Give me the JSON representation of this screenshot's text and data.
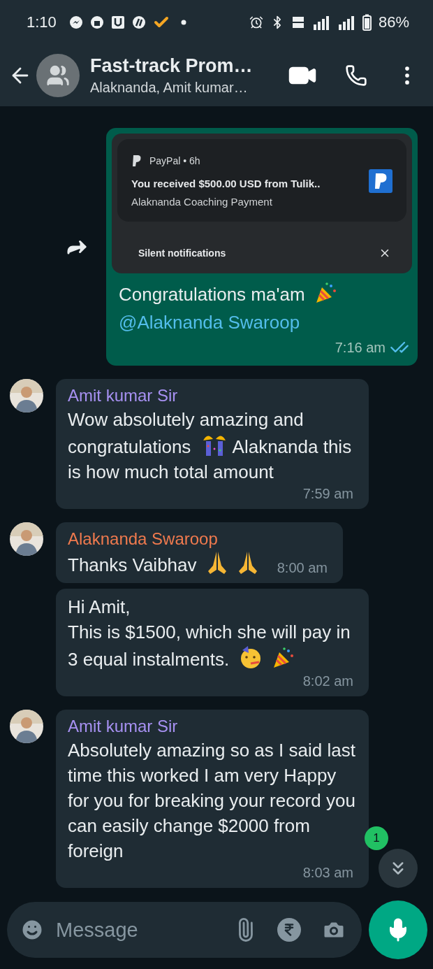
{
  "status_bar": {
    "time": "1:10",
    "battery": "86%"
  },
  "header": {
    "title": "Fast-track Prom…",
    "subtitle": "Alaknanda, Amit kumar…"
  },
  "messages": [
    {
      "kind": "outgoing",
      "notification": {
        "app": "PayPal • 6h",
        "title": "You received $500.00 USD from Tulik..",
        "body": "Alaknanda Coaching Payment",
        "footer": "Silent notifications"
      },
      "parts": [
        {
          "kind": "text",
          "text": "Congratulations ma'am"
        },
        {
          "kind": "popper"
        },
        {
          "kind": "mention",
          "text": "@Alaknanda Swaroop"
        }
      ],
      "time": "7:16 am",
      "read": true
    },
    {
      "kind": "incoming",
      "sender": "Amit kumar Sir",
      "color": "#a791f2",
      "parts": [
        {
          "kind": "text",
          "text": "Wow absolutely amazing and congratulations"
        },
        {
          "kind": "crackers"
        },
        {
          "kind": "text",
          "text": "Alaknanda this is how much total amount"
        }
      ],
      "time": "7:59 am"
    },
    {
      "kind": "incoming",
      "sender": "Alaknanda Swaroop",
      "color": "#f07a4e",
      "parts": [
        {
          "kind": "text",
          "text": "Thanks Vaibhav"
        },
        {
          "kind": "hands"
        },
        {
          "kind": "hands"
        }
      ],
      "time": "8:00 am"
    },
    {
      "kind": "incoming",
      "parts": [
        {
          "kind": "text",
          "text": "Hi Amit,"
        },
        {
          "kind": "break"
        },
        {
          "kind": "text",
          "text": "This is $1500, which she will pay in 3 equal instalments."
        },
        {
          "kind": "partyface"
        },
        {
          "kind": "popper"
        }
      ],
      "time": "8:02 am"
    },
    {
      "kind": "incoming",
      "sender": "Amit kumar Sir",
      "color": "#a791f2",
      "parts": [
        {
          "kind": "text",
          "text": "Absolutely amazing so as I said last time this worked I am very Happy for you for breaking your record you can easily change $2000 from foreign"
        }
      ],
      "time": "8:03 am"
    }
  ],
  "unread_badge": "1",
  "composer": {
    "placeholder": "Message"
  }
}
